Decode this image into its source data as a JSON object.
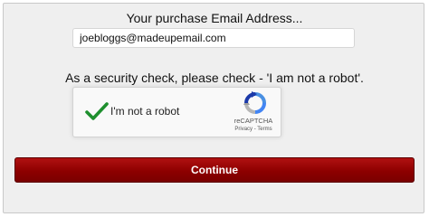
{
  "form": {
    "email_label": "Your purchase Email Address...",
    "email_value": "joebloggs@madeupemail.com",
    "security_text": "As a security check, please check - 'I am not a robot'."
  },
  "recaptcha": {
    "label": "I'm not a robot",
    "brand": "reCAPTCHA",
    "privacy_link": "Privacy",
    "separator": " - ",
    "terms_link": "Terms",
    "checked": true,
    "check_icon": "checkmark-icon",
    "logo_icon": "recaptcha-logo-icon",
    "check_color": "#1e8f2e"
  },
  "actions": {
    "continue_label": "Continue",
    "continue_color": "#8d0000"
  }
}
